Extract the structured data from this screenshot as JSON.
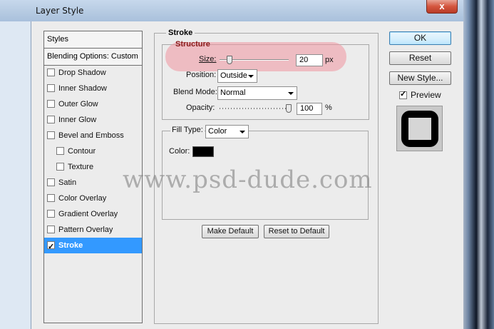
{
  "window": {
    "title": "Layer Style",
    "close_label": "x"
  },
  "styles_panel": {
    "header": "Styles",
    "blending_options": "Blending Options: Custom",
    "items": [
      {
        "label": "Drop Shadow",
        "checked": false
      },
      {
        "label": "Inner Shadow",
        "checked": false
      },
      {
        "label": "Outer Glow",
        "checked": false
      },
      {
        "label": "Inner Glow",
        "checked": false
      },
      {
        "label": "Bevel and Emboss",
        "checked": false
      },
      {
        "label": "Contour",
        "checked": false
      },
      {
        "label": "Texture",
        "checked": false
      },
      {
        "label": "Satin",
        "checked": false
      },
      {
        "label": "Color Overlay",
        "checked": false
      },
      {
        "label": "Gradient Overlay",
        "checked": false
      },
      {
        "label": "Pattern Overlay",
        "checked": false
      },
      {
        "label": "Stroke",
        "checked": true,
        "selected": true
      }
    ]
  },
  "stroke": {
    "group_label": "Stroke",
    "structure": {
      "label": "Structure",
      "size_label": "Size:",
      "size_value": "20",
      "size_unit": "px",
      "position_label": "Position:",
      "position_value": "Outside",
      "blend_mode_label": "Blend Mode:",
      "blend_mode_value": "Normal",
      "opacity_label": "Opacity:",
      "opacity_value": "100",
      "opacity_unit": "%"
    },
    "fill": {
      "fill_type_label": "Fill Type:",
      "fill_type_value": "Color",
      "color_label": "Color:",
      "color_value": "#000000"
    },
    "make_default": "Make Default",
    "reset_to_default": "Reset to Default"
  },
  "actions": {
    "ok": "OK",
    "reset": "Reset",
    "new_style": "New Style...",
    "preview_label": "Preview",
    "preview_checked": true
  },
  "watermark": "www.psd-dude.com",
  "colors": {
    "selection": "#3399ff",
    "highlight": "#f096a0",
    "swatch": "#000000"
  }
}
